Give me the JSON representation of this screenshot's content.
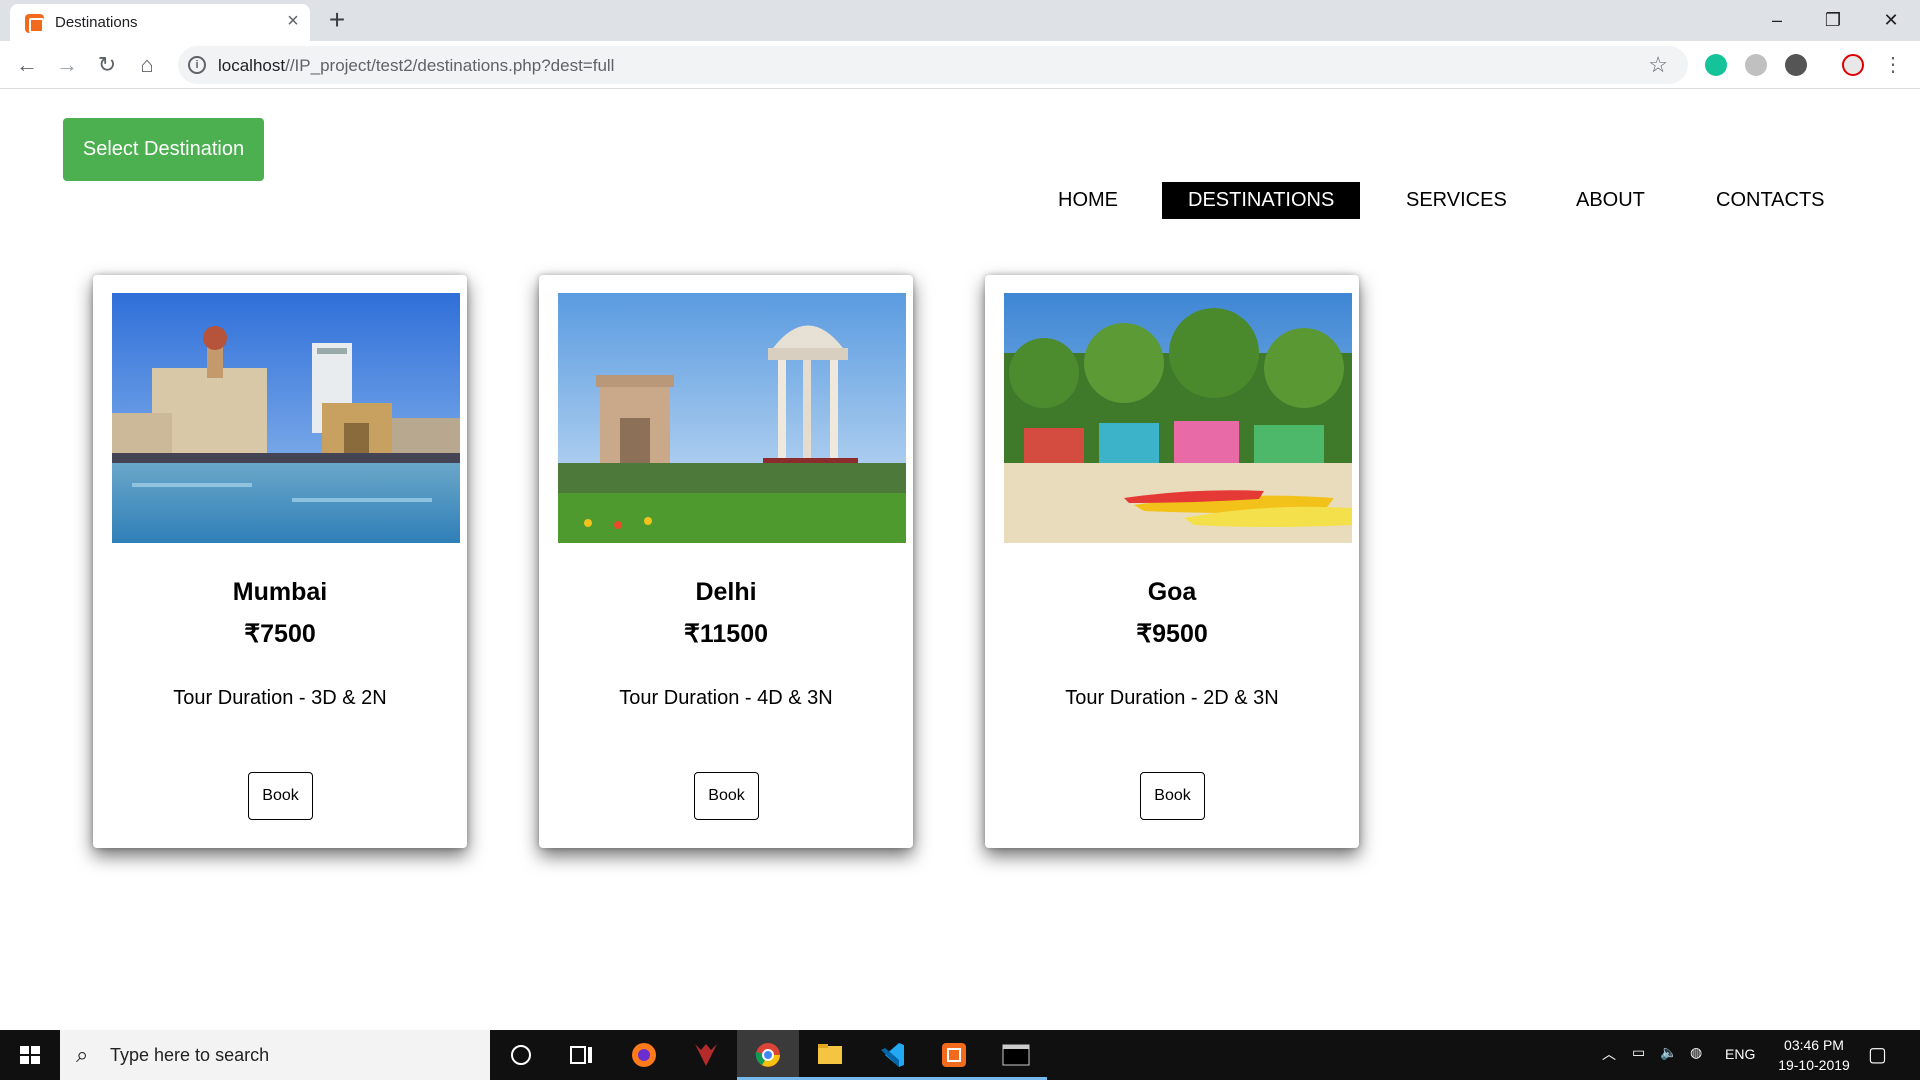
{
  "browser": {
    "tab_title": "Destinations",
    "url_host": "localhost",
    "url_path": "//IP_project/test2/destinations.php?dest=full"
  },
  "page": {
    "select_destination": "Select Destination",
    "nav": [
      "HOME",
      "DESTINATIONS",
      "SERVICES",
      "ABOUT",
      "CONTACTS"
    ],
    "active_nav": "DESTINATIONS",
    "cards": [
      {
        "name": "Mumbai",
        "price": "₹7500",
        "duration": "Tour Duration - 3D & 2N",
        "button": "Book",
        "image": "mumbai-gateway-photo"
      },
      {
        "name": "Delhi",
        "price": "₹11500",
        "duration": "Tour Duration - 4D & 3N",
        "button": "Book",
        "image": "india-gate-photo"
      },
      {
        "name": "Goa",
        "price": "₹9500",
        "duration": "Tour Duration - 2D & 3N",
        "button": "Book",
        "image": "goa-beach-photo"
      }
    ]
  },
  "taskbar": {
    "search_placeholder": "Type here to search",
    "language": "ENG",
    "time": "03:46 PM",
    "date": "19-10-2019"
  },
  "colors": {
    "primary_button": "#4caf50",
    "nav_active_bg": "#000000",
    "taskbar_bg": "#101010"
  }
}
